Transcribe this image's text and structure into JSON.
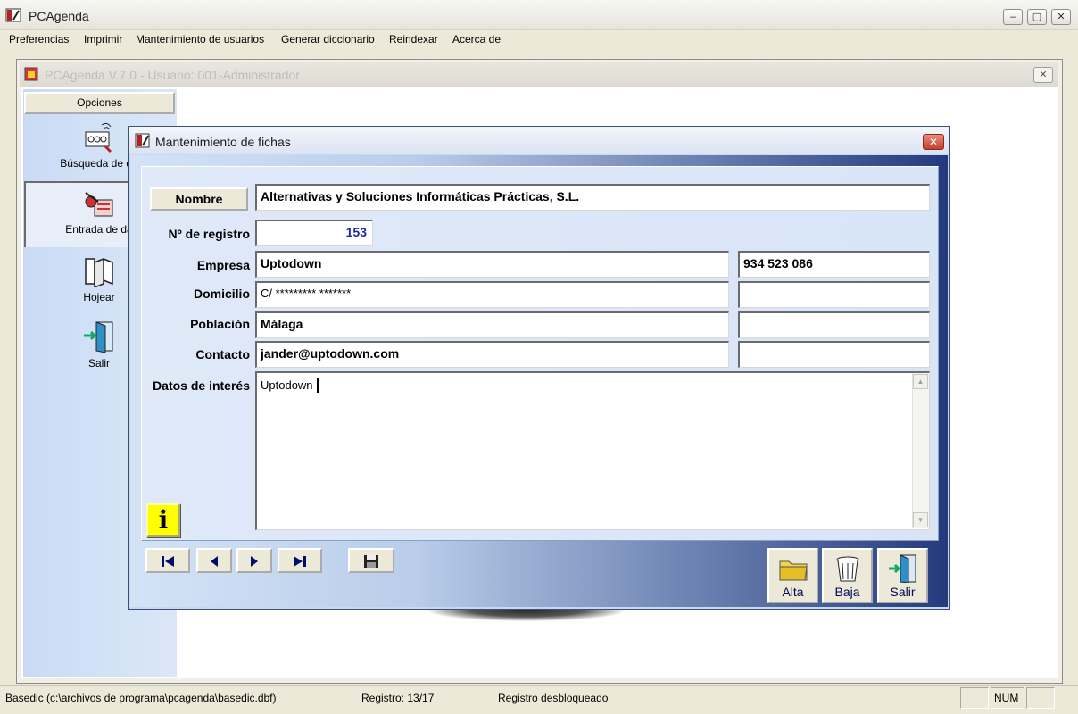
{
  "window": {
    "title": "PCAgenda",
    "controls": {
      "minimize": "–",
      "maximize": "▢",
      "close": "✕"
    }
  },
  "menu": {
    "items": [
      "Preferencias",
      "Imprimir",
      "Mantenimiento de usuarios",
      "Generar diccionario",
      "Reindexar",
      "Acerca de"
    ]
  },
  "mdi": {
    "title": "PCAgenda  V.7.0 - Usuario: 001-Administrador",
    "close_glyph": "✕"
  },
  "options_panel": {
    "header": "Opciones",
    "items": [
      {
        "label": "Búsqueda de da",
        "icon": "search-records-icon"
      },
      {
        "label": "Entrada de da",
        "icon": "data-entry-icon"
      },
      {
        "label": "Hojear",
        "icon": "book-icon"
      },
      {
        "label": "Salir",
        "icon": "exit-door-icon"
      }
    ],
    "selected_index": 1
  },
  "dialog": {
    "title": "Mantenimiento de fichas",
    "close_glyph": "✕",
    "nombre_button": "Nombre",
    "nombre_value": "Alternativas y Soluciones Informáticas Prácticas, S.L.",
    "labels": {
      "registro": "Nº de registro",
      "empresa": "Empresa",
      "domicilio": "Domicilio",
      "poblacion": "Población",
      "contacto": "Contacto",
      "datos": "Datos de interés"
    },
    "values": {
      "registro": "153",
      "empresa": "Uptodown",
      "telefono": "934 523 086",
      "domicilio": "C/ ********* *******",
      "domicilio_extra": "",
      "poblacion": "Málaga",
      "poblacion_extra": "",
      "contacto": "jander@uptodown.com",
      "contacto_extra": "",
      "datos": "Uptodown"
    },
    "info_glyph": "i",
    "nav": {
      "first": "⏮",
      "prev": "◀",
      "next": "▶",
      "last": "⏭",
      "save": "💾"
    },
    "actions": {
      "alta": "Alta",
      "baja": "Baja",
      "salir": "Salir"
    }
  },
  "status_bar": {
    "path": "Basedic (c:\\archivos de programa\\pcagenda\\basedic.dbf)",
    "registro": "Registro: 13/17",
    "lock": "Registro desbloqueado",
    "num": "NUM"
  },
  "colors": {
    "dialog_gradient_end": "#243a7c",
    "panel_blue": "#c9dbf4",
    "info_yellow": "#ffff00",
    "registro_value": "#1a2aa8"
  }
}
